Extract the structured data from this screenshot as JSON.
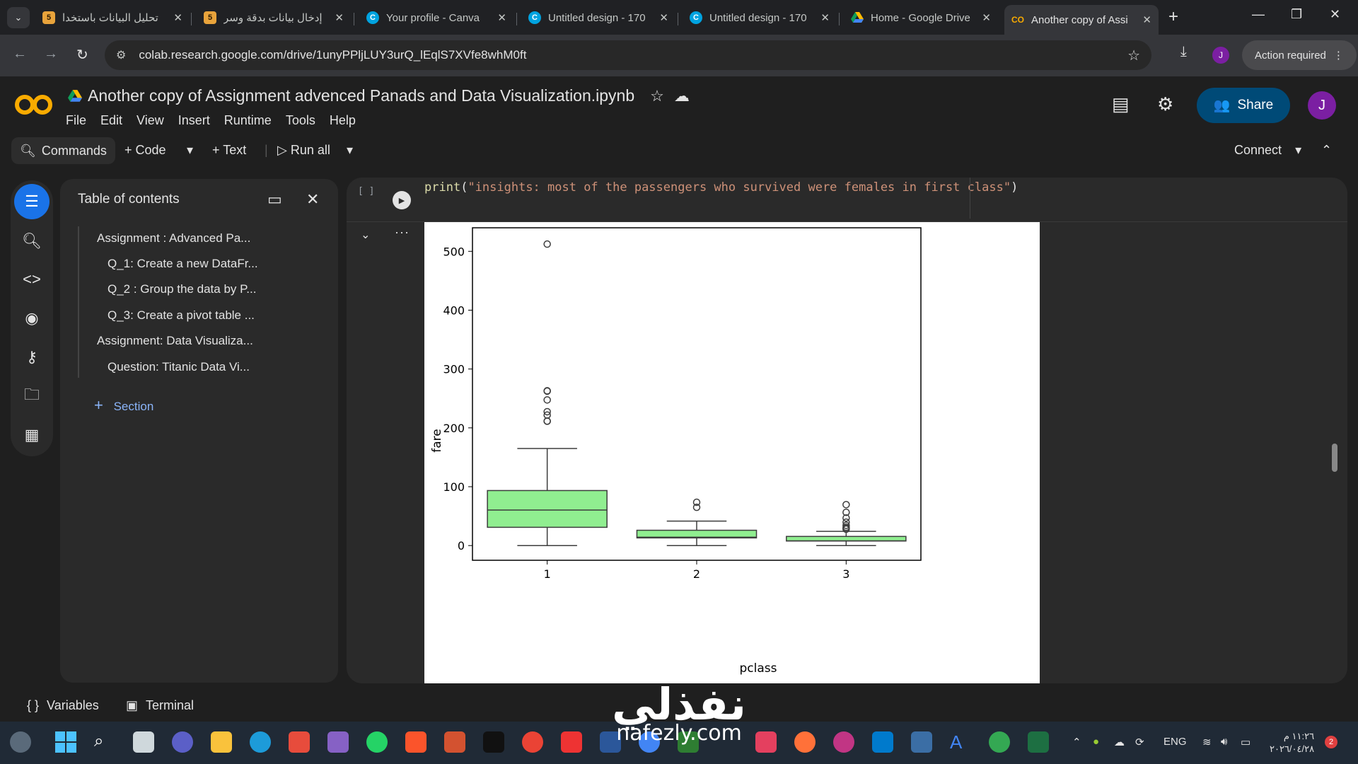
{
  "browser": {
    "tabs": [
      {
        "title": "تحليل البيانات باستخدا",
        "icon": "five-icon",
        "active": false
      },
      {
        "title": "إدخال بيانات بدقة وسر",
        "icon": "five-icon",
        "active": false
      },
      {
        "title": "Your profile - Canva",
        "icon": "canva-icon",
        "active": false
      },
      {
        "title": "Untitled design - 170",
        "icon": "canva-icon",
        "active": false
      },
      {
        "title": "Untitled design - 170",
        "icon": "canva-icon",
        "active": false
      },
      {
        "title": "Home - Google Drive",
        "icon": "drive-icon",
        "active": false
      },
      {
        "title": "Another copy of Assi",
        "icon": "colab-icon",
        "active": true
      }
    ],
    "url": "colab.research.google.com/drive/1unyPPljLUY3urQ_lEqlS7XVfe8whM0ft",
    "profile_initial": "J",
    "action_required": "Action required"
  },
  "colab": {
    "doc_title": "Another copy of Assignment advenced Panads and Data Visualization.ipynb",
    "menu": [
      "File",
      "Edit",
      "View",
      "Insert",
      "Runtime",
      "Tools",
      "Help"
    ],
    "share_label": "Share",
    "avatar_initial": "J",
    "toolbar": {
      "commands": "Commands",
      "code": "Code",
      "text": "Text",
      "run_all": "Run all",
      "connect": "Connect"
    }
  },
  "toc": {
    "title": "Table of contents",
    "items": [
      {
        "label": "Assignment : Advanced Pa...",
        "level": 1
      },
      {
        "label": "Q_1: Create a new DataFr...",
        "level": 2
      },
      {
        "label": "Q_2 : Group the data by P...",
        "level": 2
      },
      {
        "label": "Q_3: Create a pivot table ...",
        "level": 2
      },
      {
        "label": "Assignment: Data Visualiza...",
        "level": 1
      },
      {
        "label": "Question: Titanic Data Vi...",
        "level": 2
      }
    ],
    "add_section": "Section"
  },
  "cell": {
    "bracket": "[ ]",
    "code_fn": "print",
    "code_open": "(",
    "code_str": "\"insights: most of the passengers who survived were females in first class\"",
    "code_close": ")"
  },
  "chart_data": {
    "type": "box",
    "xlabel": "pclass",
    "ylabel": "fare",
    "categories": [
      "1",
      "2",
      "3"
    ],
    "ylim": [
      -25,
      540
    ],
    "yticks": [
      0,
      100,
      200,
      300,
      400,
      500
    ],
    "box_color": "#90ee90",
    "boxes": [
      {
        "category": "1",
        "whisker_low": 0,
        "q1": 31,
        "median": 60.3,
        "q3": 93.5,
        "whisker_high": 164.9,
        "outliers": [
          211.3,
          211.5,
          221.8,
          227.5,
          247.5,
          262.4,
          263.0,
          512.3
        ]
      },
      {
        "category": "2",
        "whisker_low": 0,
        "q1": 13,
        "median": 14.25,
        "q3": 26,
        "whisker_high": 41.6,
        "outliers": [
          65,
          73.5
        ]
      },
      {
        "category": "3",
        "whisker_low": 0,
        "q1": 7.75,
        "median": 8.05,
        "q3": 15.5,
        "whisker_high": 24.2,
        "outliers": [
          27.9,
          29.1,
          31.3,
          34.4,
          39.7,
          46.9,
          56.5,
          69.55
        ]
      }
    ]
  },
  "bottom": {
    "variables": "Variables",
    "terminal": "Terminal"
  },
  "taskbar": {
    "lang": "ENG",
    "time": "١١:٢٦ م",
    "date": "٢٠٢٦/٠٤/٢٨",
    "notifications": "2"
  },
  "watermark": {
    "arabic": "نفذلي",
    "latin": "nafezly.com"
  }
}
